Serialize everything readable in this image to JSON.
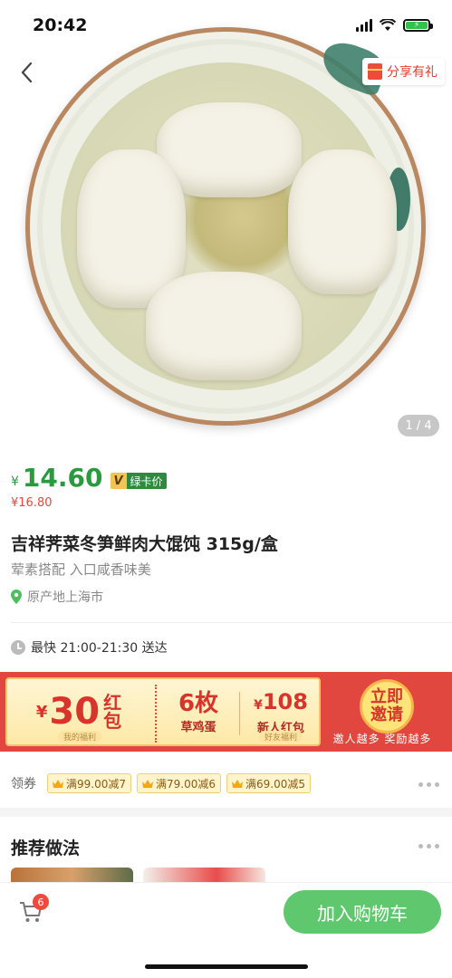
{
  "status_bar": {
    "time": "20:42"
  },
  "hero": {
    "share_label": "分享有礼",
    "image_index": "1 / 4"
  },
  "price": {
    "currency": "¥",
    "value": "14.60",
    "vip_badge": "V",
    "vip_label": "绿卡价",
    "original": "¥16.80"
  },
  "product": {
    "title": "吉祥荠菜冬笋鲜肉大馄饨 315g/盒",
    "subtitle": "荤素搭配 入口咸香味美",
    "origin": "原产地上海市"
  },
  "delivery": {
    "text": "最快 21:00-21:30 送达"
  },
  "banner": {
    "seg1_currency": "¥",
    "seg1_amount": "30",
    "seg1_unit": "红包",
    "seg1_tag": "我的福利",
    "seg2_main": "6枚",
    "seg2_sub": "草鸡蛋",
    "seg3_currency": "¥",
    "seg3_amount": "108",
    "seg3_sub": "新人红包",
    "seg3_tag": "好友福利",
    "invite_button": "立即邀请",
    "invite_note": "邀人越多  奖励越多"
  },
  "coupons": {
    "label": "领券",
    "items": [
      {
        "text": "满99.00减7"
      },
      {
        "text": "满79.00减6"
      },
      {
        "text": "满69.00减5"
      }
    ]
  },
  "recipes": {
    "title": "推荐做法"
  },
  "bottom_bar": {
    "cart_count": "6",
    "add_to_cart": "加入购物车"
  },
  "colors": {
    "brand_green": "#5fc86e",
    "price_green": "#2a9a3e",
    "accent_red": "#e2473f"
  }
}
